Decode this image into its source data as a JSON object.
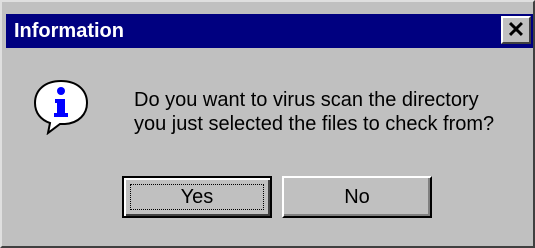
{
  "window": {
    "title": "Information",
    "close_symbol": "✕"
  },
  "icon": {
    "name": "information-icon",
    "glyph": "i",
    "color": "#0000ff"
  },
  "message": {
    "line1": "Do you want to virus scan the directory",
    "line2": "you just selected the files to check from?"
  },
  "buttons": {
    "yes_label": "Yes",
    "no_label": "No"
  }
}
